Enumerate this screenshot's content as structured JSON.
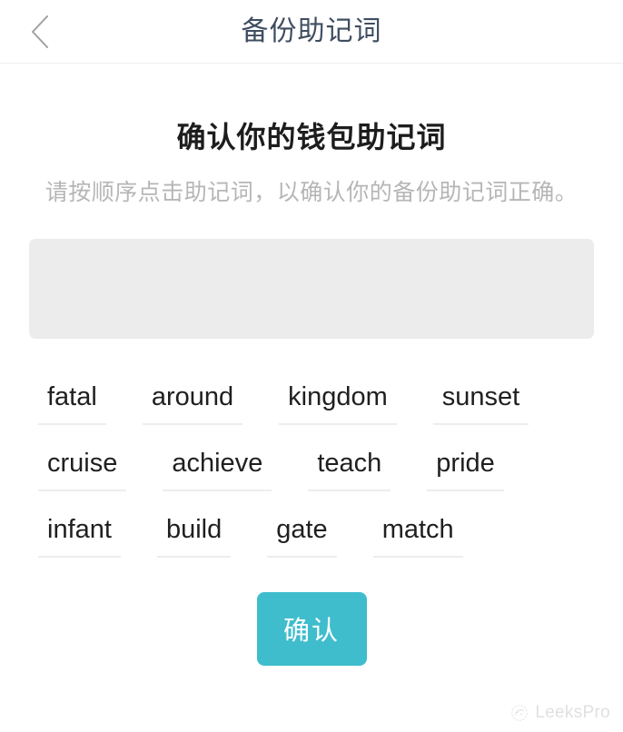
{
  "navbar": {
    "back_icon": "chevron-left-icon",
    "title": "备份助记词"
  },
  "content": {
    "title": "确认你的钱包助记词",
    "subtitle": "请按顺序点击助记词，以确认你的备份助记词正确。",
    "selected_words": [],
    "word_bank": [
      "fatal",
      "around",
      "kingdom",
      "sunset",
      "cruise",
      "achieve",
      "teach",
      "pride",
      "infant",
      "build",
      "gate",
      "match"
    ],
    "confirm_label": "确认"
  },
  "watermark": {
    "text": "LeeksPro",
    "logo_icon": "leekspro-logo-icon"
  },
  "colors": {
    "nav_title": "#3f4d60",
    "accent": "#3fbdcd",
    "answer_box_bg": "#ececec",
    "subtitle": "#b6b6b6",
    "chip_underline": "#ededed"
  }
}
